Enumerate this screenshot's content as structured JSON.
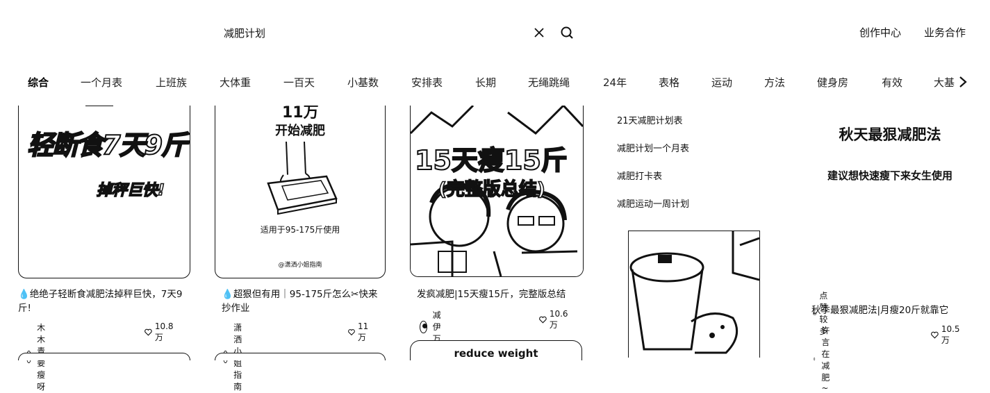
{
  "search": {
    "query": "减肥计划"
  },
  "header": {
    "creator_center": "创作中心",
    "business": "业务合作"
  },
  "tabs": [
    "综合",
    "一个月表",
    "上班族",
    "大体重",
    "一百天",
    "小基数",
    "安排表",
    "长期",
    "无绳跳绳",
    "24年",
    "表格",
    "运动",
    "方法",
    "健身房",
    "有效",
    "大基"
  ],
  "cards": [
    {
      "thumb_title": "轻断食7天9斤",
      "thumb_sub": "掉秤巨快!",
      "caption": "绝绝子轻断食减肥法掉秤巨快，7天9斤!",
      "author": "木木青要瘦呀",
      "likes": "10.8万"
    },
    {
      "thumb_top": "11万",
      "thumb_title": "开始减肥",
      "thumb_sub": "适用于95-175斤使用",
      "thumb_small": "@潇洒小姐指南",
      "caption": "超狠但有用｜95-175斤怎么✂快来抄作业",
      "author": "潇洒小姐指南",
      "likes": "11万"
    },
    {
      "thumb_title": "15天瘦15斤",
      "thumb_sub": "(完整版总结)",
      "caption": "发疯减肥|15天瘦15斤，完整版总结",
      "author": "减伊万",
      "likes": "10.6万",
      "next_peek": "reduce weight"
    },
    {
      "suggestions": [
        "21天减肥计划表",
        "减肥计划一个月表",
        "减肥打卡表",
        "减肥运动一周计划"
      ]
    },
    {
      "thumb_title": "秋天最狠减肥法",
      "thumb_sub": "建议想快速瘦下来女生使用",
      "badge": "点赞较多",
      "caption": "秋季最狠减肥法|月瘦20斤就靠它",
      "author": "许言在减肥~",
      "likes": "10.5万"
    }
  ]
}
